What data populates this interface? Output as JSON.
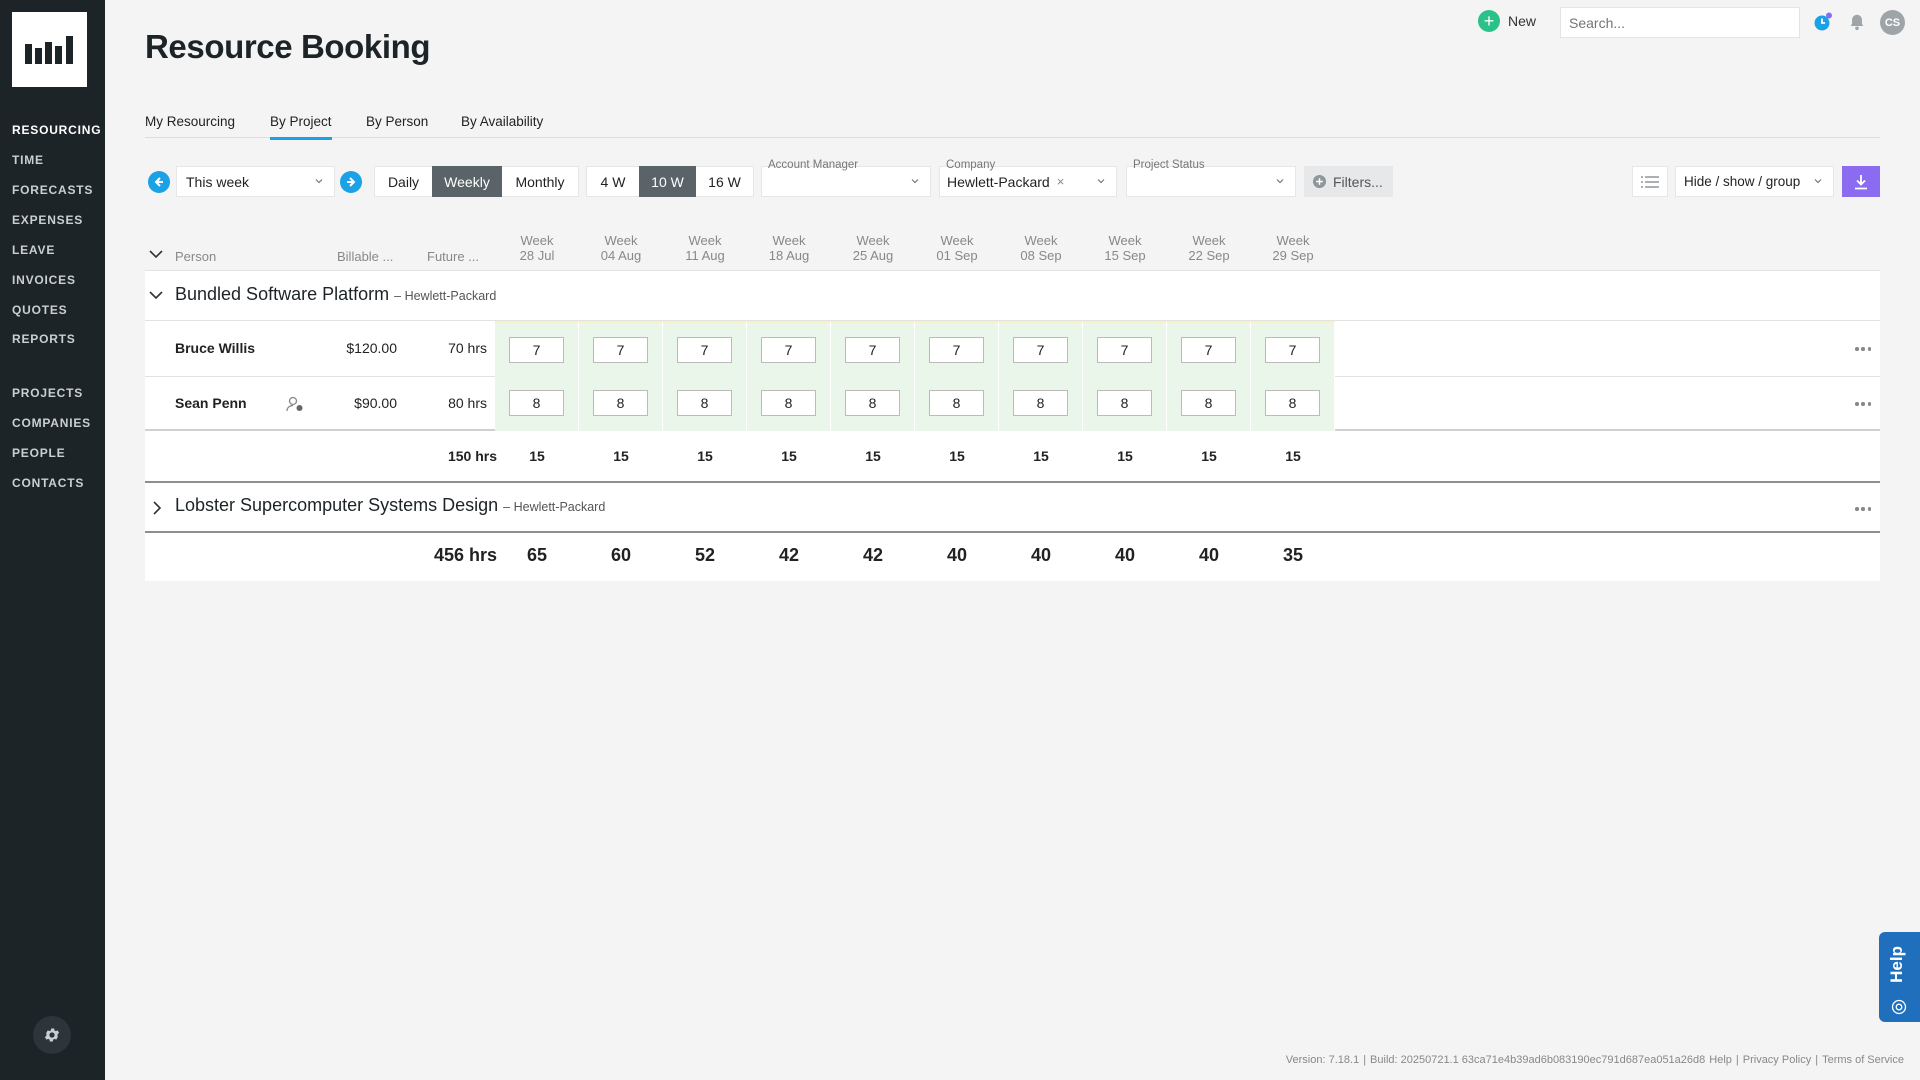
{
  "page": {
    "title": "Resource Booking"
  },
  "sidebar": {
    "top_items": [
      "RESOURCING",
      "TIME",
      "FORECASTS",
      "EXPENSES",
      "LEAVE",
      "INVOICES",
      "QUOTES",
      "REPORTS"
    ],
    "bottom_items": [
      "PROJECTS",
      "COMPANIES",
      "PEOPLE",
      "CONTACTS"
    ],
    "active": "RESOURCING"
  },
  "header": {
    "new_label": "New",
    "search_placeholder": "Search...",
    "avatar_initials": "CS"
  },
  "tabs": [
    {
      "label": "My Resourcing",
      "active": false
    },
    {
      "label": "By Project",
      "active": true
    },
    {
      "label": "By Person",
      "active": false
    },
    {
      "label": "By Availability",
      "active": false
    }
  ],
  "toolbar": {
    "date_range": "This week",
    "granularity": {
      "options": [
        "Daily",
        "Weekly",
        "Monthly"
      ],
      "selected": "Weekly"
    },
    "span": {
      "options": [
        "4 W",
        "10 W",
        "16 W"
      ],
      "selected": "10 W"
    },
    "account_manager": {
      "label": "Account Manager",
      "value": ""
    },
    "company": {
      "label": "Company",
      "value": "Hewlett-Packard"
    },
    "project_status": {
      "label": "Project Status",
      "value": ""
    },
    "filters_label": "Filters...",
    "hide_show_label": "Hide / show / group"
  },
  "table": {
    "columns": {
      "person": "Person",
      "billable": "Billable ...",
      "future": "Future ..."
    },
    "week_label": "Week",
    "weeks": [
      "28 Jul",
      "04 Aug",
      "11 Aug",
      "18 Aug",
      "25 Aug",
      "01 Sep",
      "08 Sep",
      "15 Sep",
      "22 Sep",
      "29 Sep"
    ],
    "groups": [
      {
        "title": "Bundled Software Platform",
        "company": "– Hewlett-Packard",
        "expanded": true,
        "rows": [
          {
            "name": "Bruce Willis",
            "billable": "$120.00",
            "future": "70 hrs",
            "hours": [
              "7",
              "7",
              "7",
              "7",
              "7",
              "7",
              "7",
              "7",
              "7",
              "7"
            ]
          },
          {
            "name": "Sean Penn",
            "billable": "$90.00",
            "future": "80 hrs",
            "hours": [
              "8",
              "8",
              "8",
              "8",
              "8",
              "8",
              "8",
              "8",
              "8",
              "8"
            ]
          }
        ],
        "total_label": "150 hrs",
        "totals": [
          "15",
          "15",
          "15",
          "15",
          "15",
          "15",
          "15",
          "15",
          "15",
          "15"
        ]
      },
      {
        "title": "Lobster Supercomputer Systems Design",
        "company": "– Hewlett-Packard",
        "expanded": false
      }
    ],
    "grand_total_label": "456 hrs",
    "grand_totals": [
      "65",
      "60",
      "52",
      "42",
      "42",
      "40",
      "40",
      "40",
      "40",
      "35"
    ]
  },
  "help": {
    "label": "Help"
  },
  "footer": {
    "version": "Version: 7.18.1",
    "build": "Build: 20250721.1 63ca71e4b39ad6b083190ec791d687ea051a26d8",
    "links": [
      "Help",
      "Privacy Policy",
      "Terms of Service"
    ]
  },
  "colors": {
    "accent": "#1aa1e6",
    "sidebar": "#1d2427",
    "new_green": "#2bc28a",
    "download": "#8b6cf0",
    "cell_green": "#ebf6ea"
  }
}
